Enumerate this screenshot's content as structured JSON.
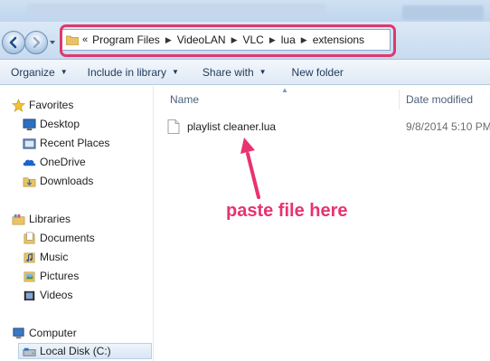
{
  "address_bar": {
    "chevrons": "«",
    "crumbs": [
      "Program Files",
      "VideoLAN",
      "VLC",
      "lua",
      "extensions"
    ]
  },
  "toolbar": {
    "organize": "Organize",
    "include_in_library": "Include in library",
    "share_with": "Share with",
    "new_folder": "New folder"
  },
  "nav_pane": {
    "favorites": {
      "label": "Favorites",
      "items": [
        "Desktop",
        "Recent Places",
        "OneDrive",
        "Downloads"
      ]
    },
    "libraries": {
      "label": "Libraries",
      "items": [
        "Documents",
        "Music",
        "Pictures",
        "Videos"
      ]
    },
    "computer": {
      "label": "Computer",
      "items": [
        "Local Disk (C:)"
      ]
    }
  },
  "file_list": {
    "columns": {
      "name": "Name",
      "date_modified": "Date modified"
    },
    "rows": [
      {
        "name": "playlist cleaner.lua",
        "date_modified": "9/8/2014 5:10 PM"
      }
    ]
  },
  "annotation": {
    "text": "paste file here",
    "color": "#e8336f"
  },
  "colors": {
    "highlight": "#e0386e",
    "toolbar_text": "#1e395b"
  }
}
